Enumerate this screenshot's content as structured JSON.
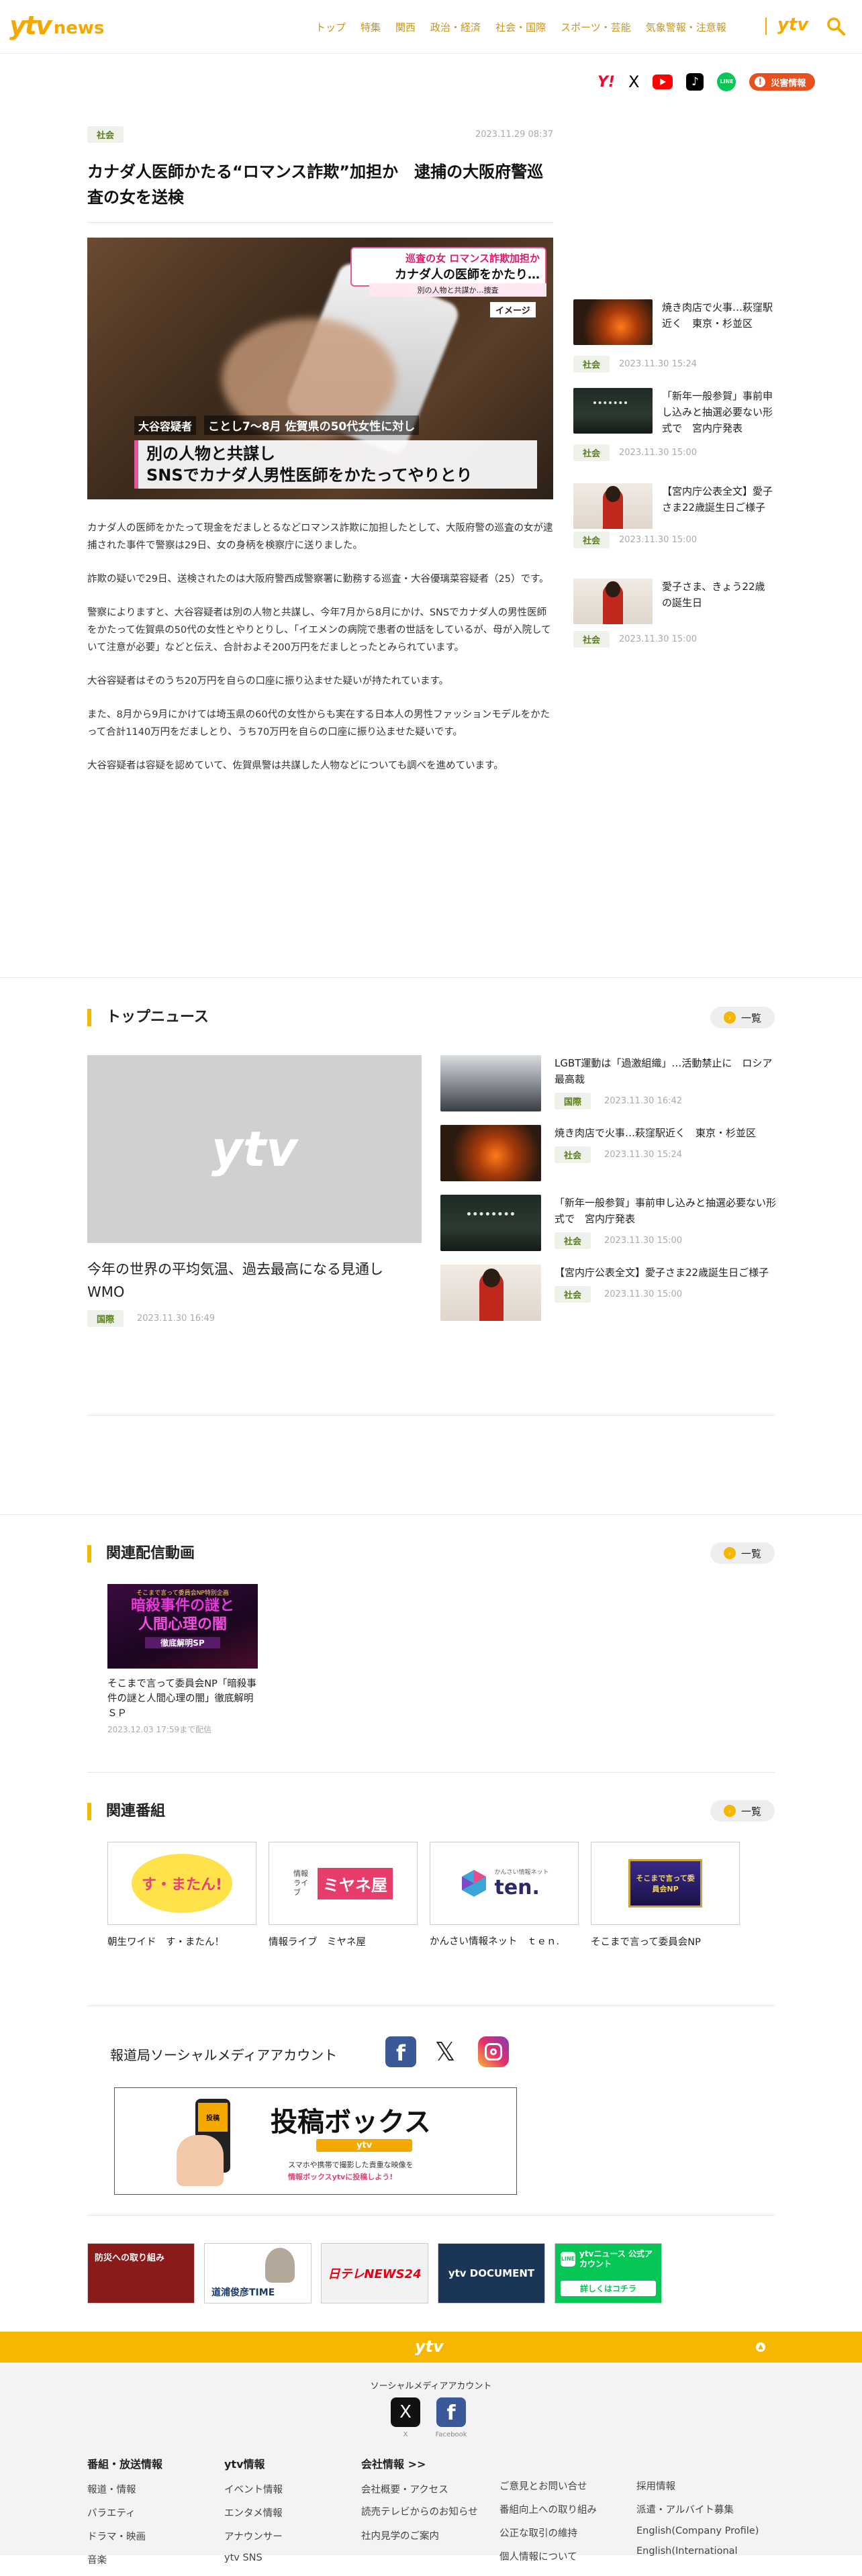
{
  "header": {
    "logo_main": "ytv",
    "logo_sub": "news",
    "nav": [
      "トップ",
      "特集",
      "関西",
      "政治・経済",
      "社会・国際",
      "スポーツ・芸能",
      "気象警報・注意報"
    ],
    "brand": "ytv"
  },
  "share": {
    "icons": [
      "yahoo-icon",
      "x-icon",
      "youtube-icon",
      "tiktok-icon",
      "line-icon"
    ],
    "yahoo_label": "Y!",
    "x_label": "X",
    "line_label": "LINE",
    "alert_label": "災害情報"
  },
  "article": {
    "tag": "社会",
    "date": "2023.11.29 08:37",
    "title": "カナダ人医師かたる“ロマンス詐欺”加担か　逮捕の大阪府警巡査の女を送検",
    "image": {
      "caption_top1": "巡査の女 ロマンス詐欺加担か",
      "caption_top2": "カナダ人の医師をかたり…",
      "caption_top3": "別の人物と共謀か…捜査",
      "image_label": "イメージ",
      "name_tag": "大谷容疑者",
      "sub_caption": "ことし7～8月 佐賀県の50代女性に対し",
      "main_caption1": "別の人物と共謀し",
      "main_caption2": "SNSでカナダ人男性医師をかたってやりとり"
    },
    "paragraphs": [
      "カナダ人の医師をかたって現金をだましとるなどロマンス詐欺に加担したとして、大阪府警の巡査の女が逮捕された事件で警察は29日、女の身柄を検察庁に送りました。",
      "詐欺の疑いで29日、送検されたのは大阪府警西成警察署に勤務する巡査・大谷優璃菜容疑者（25）です。",
      "警察によりますと、大谷容疑者は別の人物と共謀し、今年7月から8月にかけ、SNSでカナダ人の男性医師をかたって佐賀県の50代の女性とやりとりし、「イエメンの病院で患者の世話をしているが、母が入院していて注意が必要」などと伝え、合計およそ200万円をだましとったとみられています。",
      "大谷容疑者はそのうち20万円を自らの口座に振り込ませた疑いが持たれています。",
      "また、8月から9月にかけては埼玉県の60代の女性からも実在する日本人の男性ファッションモデルをかたって合計1140万円をだましとり、うち70万円を自らの口座に振り込ませた疑いです。",
      "大谷容疑者は容疑を認めていて、佐賀県警は共謀した人物などについても調べを進めています。"
    ]
  },
  "sidebar": [
    {
      "title": "焼き肉店で火事…萩窪駅近く　東京・杉並区",
      "tag": "社会",
      "date": "2023.11.30 15:24",
      "thumb": "fire"
    },
    {
      "title": "「新年一般参賀」事前申し込みと抽選必要ない形式で　宮内庁発表",
      "tag": "社会",
      "date": "2023.11.30 15:00",
      "thumb": "palace"
    },
    {
      "title": "【宮内庁公表全文】愛子さま22歳誕生日ご様子",
      "tag": "社会",
      "date": "2023.11.30 15:00",
      "thumb": "princess"
    },
    {
      "title": "愛子さま、きょう22歳の誕生日",
      "tag": "社会",
      "date": "2023.11.30 15:00",
      "thumb": "princess"
    }
  ],
  "top_news": {
    "heading": "トップニュース",
    "more": "一覧",
    "featured": {
      "placeholder_logo": "ytv",
      "title": "今年の世界の平均気温、過去最高になる見通し　WMO",
      "tag": "国際",
      "date": "2023.11.30 16:49"
    },
    "items": [
      {
        "title": "LGBT運動は「過激組織」…活動禁止に　ロシア最高裁",
        "tag": "国際",
        "date": "2023.11.30 16:42",
        "thumb": "court"
      },
      {
        "title": "焼き肉店で火事…萩窪駅近く　東京・杉並区",
        "tag": "社会",
        "date": "2023.11.30 15:24",
        "thumb": "fire"
      },
      {
        "title": "「新年一般参賀」事前申し込みと抽選必要ない形式で　宮内庁発表",
        "tag": "社会",
        "date": "2023.11.30 15:00",
        "thumb": "palace"
      },
      {
        "title": "【宮内庁公表全文】愛子さま22歳誕生日ご様子",
        "tag": "社会",
        "date": "2023.11.30 15:00",
        "thumb": "princess"
      }
    ]
  },
  "related_videos": {
    "heading": "関連配信動画",
    "more": "一覧",
    "items": [
      {
        "thumb_line1": "そこまで言って委員会NP特別企画",
        "thumb_line2": "暗殺事件の謎と",
        "thumb_line3": "人間心理の闇",
        "thumb_line4": "徹底解明SP",
        "title": "そこまで言って委員会NP「暗殺事件の謎と人間心理の闇」徹底解明ＳＰ",
        "until": "2023.12.03 17:59まで配信"
      }
    ]
  },
  "related_programs": {
    "heading": "関連番組",
    "more": "一覧",
    "items": [
      {
        "logo": "す・またん!",
        "name": "朝生ワイド　す・またん！"
      },
      {
        "logo_sub": "情報ライブ",
        "logo": "ミヤネ屋",
        "name": "情報ライブ　ミヤネ屋"
      },
      {
        "logo_sub": "かんさい情報ネット",
        "logo": "ten.",
        "name": "かんさい情報ネット　ｔｅｎ."
      },
      {
        "logo": "そこまで言って委員会NP",
        "name": "そこまで言って委員会NP"
      }
    ]
  },
  "social": {
    "label": "報道局ソーシャルメディアアカウント",
    "box_title": "投稿ボックス",
    "box_brand": "ytv",
    "box_desc1": "スマホや携帯で撮影した貴重な映像を",
    "box_desc2": "情報ボックスytvに投稿しよう!",
    "phone_label": "投稿"
  },
  "banners": [
    {
      "text": "防災への取り組み",
      "color": "#8b1a1a"
    },
    {
      "text": "道浦俊彦TIME",
      "color": "#ffffff"
    },
    {
      "text": "日テレNEWS24",
      "color": "#f2f2f2"
    },
    {
      "text": "ytv DOCUMENT",
      "color": "#1b3557"
    },
    {
      "text": "ytvニュース 公式アカウント",
      "sub": "詳しくはコチラ",
      "color": "#06c755"
    }
  ],
  "footer": {
    "brand": "ytv",
    "social_label": "ソーシャルメディアアカウント",
    "x_label": "X",
    "fb_label": "Facebook",
    "columns": [
      {
        "title": "番組・放送情報",
        "items": [
          "報道・情報",
          "バラエティ",
          "ドラマ・映画",
          "音楽"
        ]
      },
      {
        "title": "ytv情報",
        "items": [
          "イベント情報",
          "エンタメ情報",
          "アナウンサー",
          "ytv SNS"
        ]
      },
      {
        "title": "会社情報 >>",
        "items": [
          "会社概要・アクセス",
          "読売テレビからのお知らせ",
          "社内見学のご案内"
        ]
      },
      {
        "title": "",
        "items": [
          "ご意見とお問い合せ",
          "番組向上への取り組み",
          "公正な取引の維持",
          "個人情報について"
        ]
      },
      {
        "title": "",
        "items": [
          "採用情報",
          "派遣・アルバイト募集",
          "English(Company Profile)",
          "English(International"
        ]
      }
    ]
  }
}
